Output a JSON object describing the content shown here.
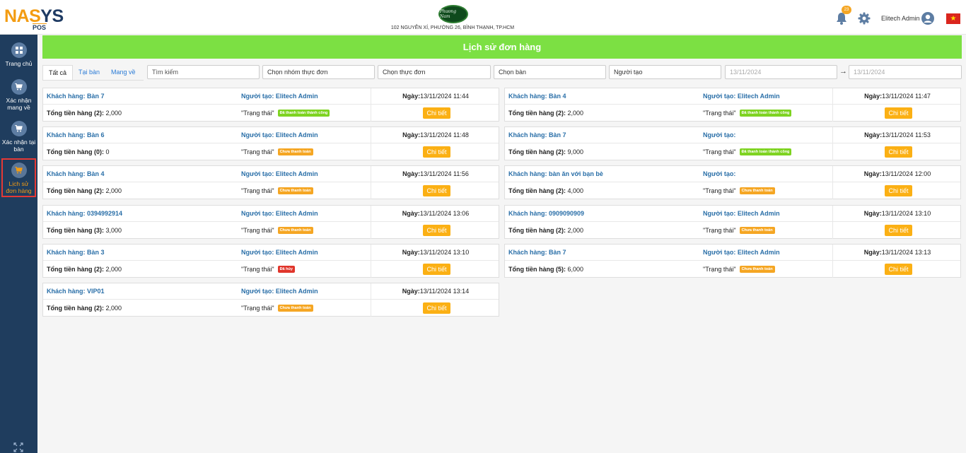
{
  "header": {
    "logo_part1": "NAS",
    "logo_part2": "YS",
    "logo_sub": "POS",
    "store_logo_text": "Phương Nam",
    "store_address": "102 NGUYỄN XÍ, PHƯỜNG 26, BÌNH THẠNH, TP.HCM",
    "notification_count": "23",
    "admin_name": "Elitech Admin",
    "flag_star": "★"
  },
  "sidebar": {
    "items": [
      {
        "label": "Trang chủ"
      },
      {
        "label": "Xác nhận mang về"
      },
      {
        "label": "Xác nhận tại bàn"
      },
      {
        "label": "Lịch sử đơn hàng"
      }
    ]
  },
  "page": {
    "title": "Lịch sử đơn hàng"
  },
  "filters": {
    "tabs": [
      "Tất cả",
      "Tại bàn",
      "Mang về"
    ],
    "search_placeholder": "Tìm kiếm",
    "menu_group": "Chọn nhóm thực đơn",
    "menu": "Chọn thực đơn",
    "table": "Chọn bàn",
    "creator": "Người tạo",
    "date_from": "13/11/2024",
    "date_to": "13/11/2024",
    "arrow": "→"
  },
  "labels": {
    "status": "\"Trạng thái\"",
    "detail_button": "Chi tiết"
  },
  "colors": {
    "title_bar": "#7ce043",
    "sidebar": "#1f3d5e",
    "detail_button": "#fbb014",
    "paid": "#7ed321",
    "unpaid": "#f5a623",
    "cancel": "#e0352b"
  },
  "orders": [
    {
      "customer": "Khách hàng: Bàn 7",
      "creator": "Người tạo: Elitech Admin",
      "date_label": "Ngày:",
      "date": "13/11/2024 11:44",
      "total_label": "Tổng tiền hàng (2):",
      "total": " 2,000",
      "status": "Đã thanh toán thành công",
      "status_type": "paid"
    },
    {
      "customer": "Khách hàng: Bàn 4",
      "creator": "Người tạo: Elitech Admin",
      "date_label": "Ngày:",
      "date": "13/11/2024 11:47",
      "total_label": "Tổng tiền hàng (2):",
      "total": " 2,000",
      "status": "Đã thanh toán thành công",
      "status_type": "paid"
    },
    {
      "customer": "Khách hàng: Bàn 6",
      "creator": "Người tạo: Elitech Admin",
      "date_label": "Ngày:",
      "date": "13/11/2024 11:48",
      "total_label": "Tổng tiền hàng (0):",
      "total": " 0",
      "status": "Chưa thanh toán",
      "status_type": "unpaid"
    },
    {
      "customer": "Khách hàng: Bàn 7",
      "creator": "Người tạo:",
      "date_label": "Ngày:",
      "date": "13/11/2024 11:53",
      "total_label": "Tổng tiền hàng (2):",
      "total": " 9,000",
      "status": "Đã thanh toán thành công",
      "status_type": "paid"
    },
    {
      "customer": "Khách hàng: Bàn 4",
      "creator": "Người tạo: Elitech Admin",
      "date_label": "Ngày:",
      "date": "13/11/2024 11:56",
      "total_label": "Tổng tiền hàng (2):",
      "total": " 2,000",
      "status": "Chưa thanh toán",
      "status_type": "unpaid"
    },
    {
      "customer": "Khách hàng: bàn ăn với bạn bè",
      "creator": "Người tạo:",
      "date_label": "Ngày:",
      "date": "13/11/2024 12:00",
      "total_label": "Tổng tiền hàng (2):",
      "total": " 4,000",
      "status": "Chưa thanh toán",
      "status_type": "unpaid"
    },
    {
      "customer": "Khách hàng: 0394992914",
      "creator": "Người tạo: Elitech Admin",
      "date_label": "Ngày:",
      "date": "13/11/2024 13:06",
      "total_label": "Tổng tiền hàng (3):",
      "total": " 3,000",
      "status": "Chưa thanh toán",
      "status_type": "unpaid"
    },
    {
      "customer": "Khách hàng: 0909090909",
      "creator": "Người tạo: Elitech Admin",
      "date_label": "Ngày:",
      "date": "13/11/2024 13:10",
      "total_label": "Tổng tiền hàng (2):",
      "total": " 2,000",
      "status": "Chưa thanh toán",
      "status_type": "unpaid"
    },
    {
      "customer": "Khách hàng: Bàn 3",
      "creator": "Người tạo: Elitech Admin",
      "date_label": "Ngày:",
      "date": "13/11/2024 13:10",
      "total_label": "Tổng tiền hàng (2):",
      "total": " 2,000",
      "status": "Đã hủy",
      "status_type": "cancel"
    },
    {
      "customer": "Khách hàng: Bàn 7",
      "creator": "Người tạo: Elitech Admin",
      "date_label": "Ngày:",
      "date": "13/11/2024 13:13",
      "total_label": "Tổng tiền hàng (5):",
      "total": " 6,000",
      "status": "Chưa thanh toán",
      "status_type": "unpaid"
    },
    {
      "customer": "Khách hàng: VIP01",
      "creator": "Người tạo: Elitech Admin",
      "date_label": "Ngày:",
      "date": "13/11/2024 13:14",
      "total_label": "Tổng tiền hàng (2):",
      "total": " 2,000",
      "status": "Chưa thanh toán",
      "status_type": "unpaid"
    }
  ]
}
